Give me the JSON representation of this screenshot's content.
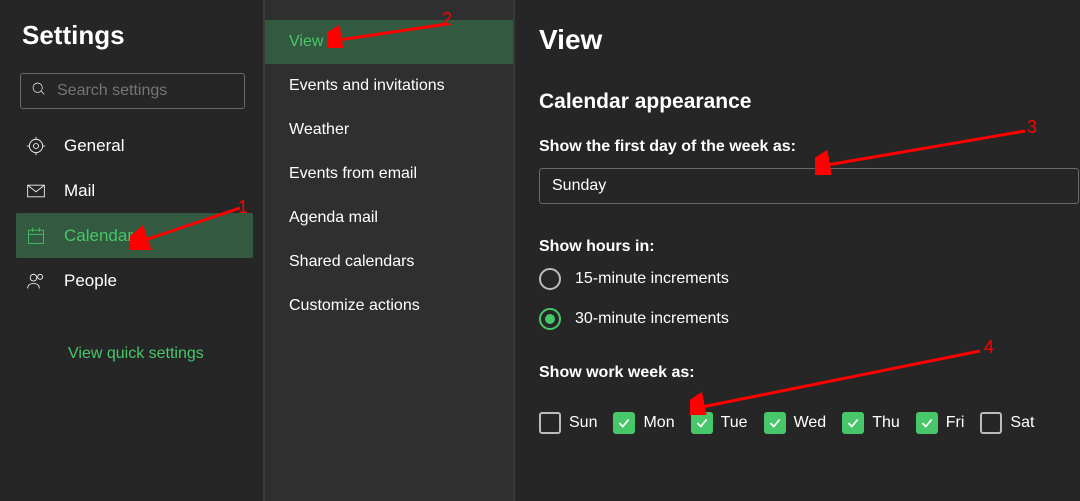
{
  "sidebar": {
    "title": "Settings",
    "search_placeholder": "Search settings",
    "items": [
      {
        "label": "General"
      },
      {
        "label": "Mail"
      },
      {
        "label": "Calendar"
      },
      {
        "label": "People"
      }
    ],
    "quick_link": "View quick settings"
  },
  "subnav": {
    "items": [
      {
        "label": "View"
      },
      {
        "label": "Events and invitations"
      },
      {
        "label": "Weather"
      },
      {
        "label": "Events from email"
      },
      {
        "label": "Agenda mail"
      },
      {
        "label": "Shared calendars"
      },
      {
        "label": "Customize actions"
      }
    ]
  },
  "main": {
    "heading": "View",
    "section_title": "Calendar appearance",
    "first_day_label": "Show the first day of the week as:",
    "first_day_value": "Sunday",
    "hours_label": "Show hours in:",
    "hours_options": {
      "opt15": "15-minute increments",
      "opt30": "30-minute increments"
    },
    "work_week_label": "Show work week as:",
    "days": {
      "sun": "Sun",
      "mon": "Mon",
      "tue": "Tue",
      "wed": "Wed",
      "thu": "Thu",
      "fri": "Fri",
      "sat": "Sat"
    }
  },
  "annotations": {
    "a1": "1",
    "a2": "2",
    "a3": "3",
    "a4": "4"
  }
}
